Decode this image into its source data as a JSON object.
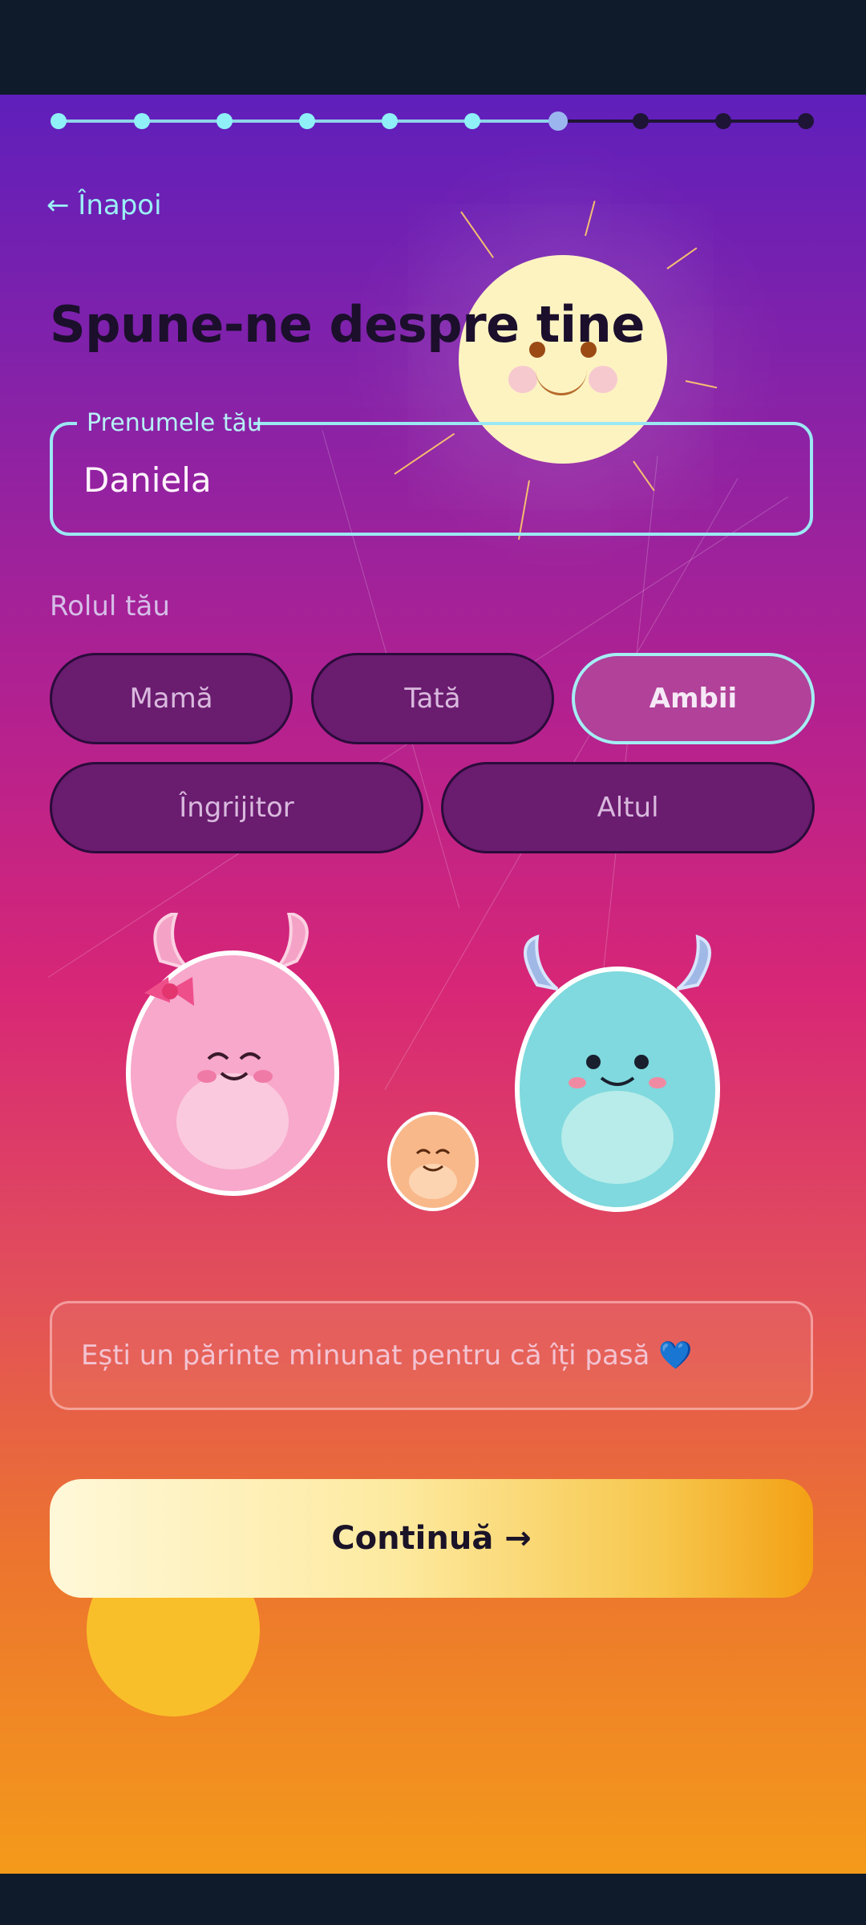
{
  "progress": {
    "total_steps": 10,
    "current_step": 7
  },
  "nav": {
    "back_label": "← Înapoi"
  },
  "header": {
    "title": "Spune-ne despre tine"
  },
  "name_field": {
    "label": "Prenumele tău",
    "value": "Daniela"
  },
  "role": {
    "label": "Rolul tău",
    "options": [
      "Mamă",
      "Tată",
      "Ambii",
      "Îngrijitor",
      "Altul"
    ],
    "selected": "Ambii"
  },
  "illustration": {
    "icon": "monster-family-illustration"
  },
  "encouragement": {
    "text": "Ești un părinte minunat pentru că îți pasă 💙"
  },
  "cta": {
    "label": "Continuă →"
  },
  "colors": {
    "accent_cyan": "#9be8f4",
    "chip_bg": "#6a1c6f",
    "chip_selected_bg": "#b14199",
    "gradient_top": "#5f1fbb",
    "gradient_bottom": "#f49a1a"
  }
}
